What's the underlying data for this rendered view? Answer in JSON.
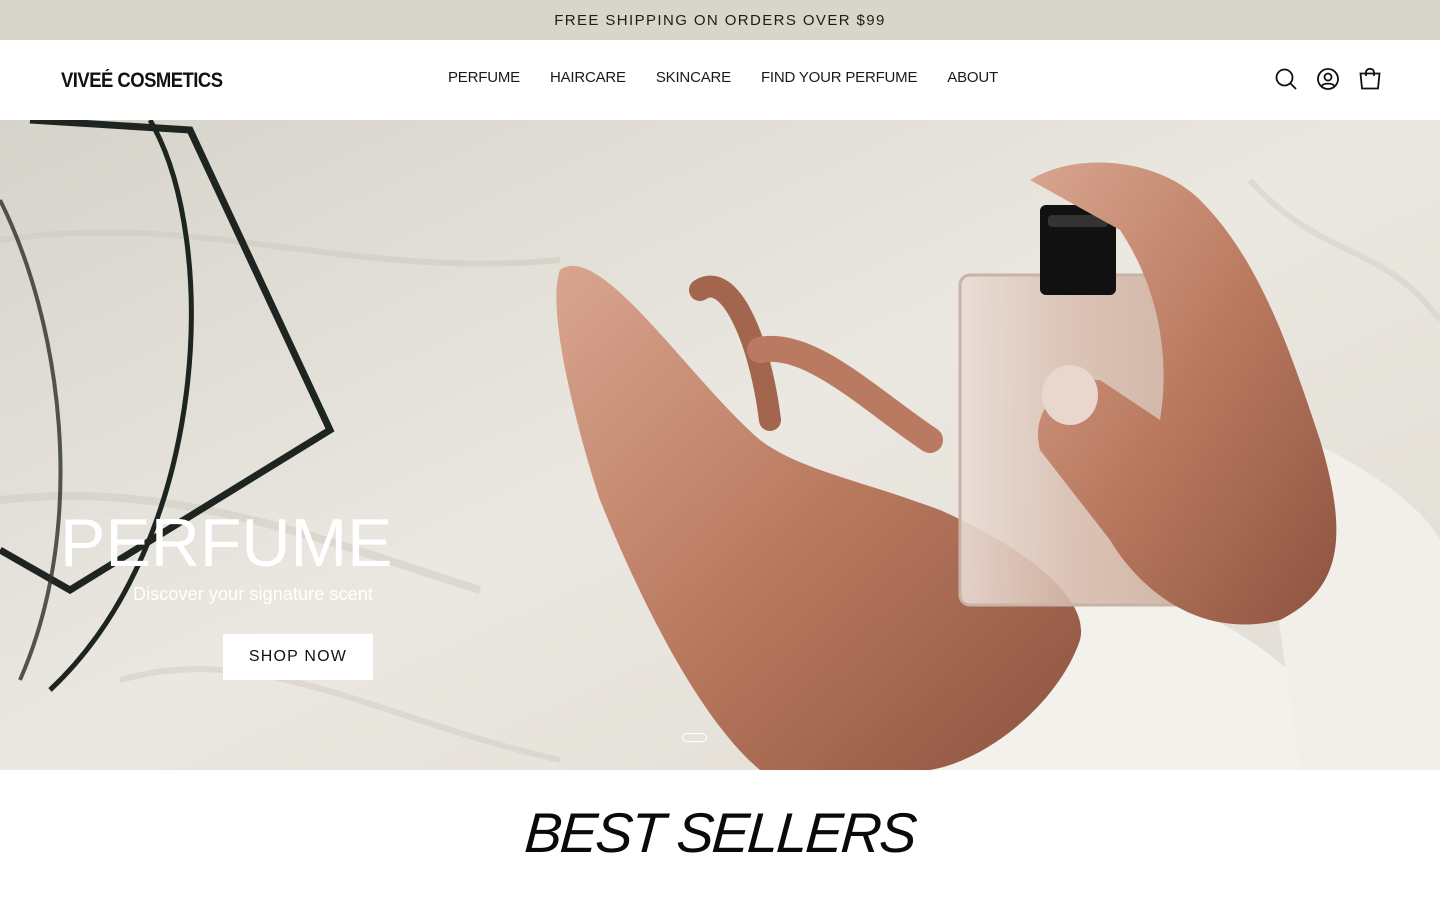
{
  "announcement": {
    "text": "FREE SHIPPING ON ORDERS OVER $99"
  },
  "header": {
    "logo": "VIVEÉ COSMETICS",
    "nav": [
      {
        "label": "PERFUME"
      },
      {
        "label": "HAIRCARE"
      },
      {
        "label": "SKINCARE"
      },
      {
        "label": "FIND YOUR PERFUME"
      },
      {
        "label": "ABOUT"
      }
    ],
    "icons": [
      "search-icon",
      "account-icon",
      "cart-icon"
    ]
  },
  "hero": {
    "title": "PERFUME",
    "subtitle": "Discover your signature scent",
    "cta": "SHOP NOW",
    "slides": 2,
    "active_slide": 1
  },
  "best_sellers": {
    "heading": "BEST SELLERS"
  },
  "colors": {
    "announcement_bg": "#d8d5ca",
    "text": "#111111",
    "hero_text": "#ffffff"
  }
}
